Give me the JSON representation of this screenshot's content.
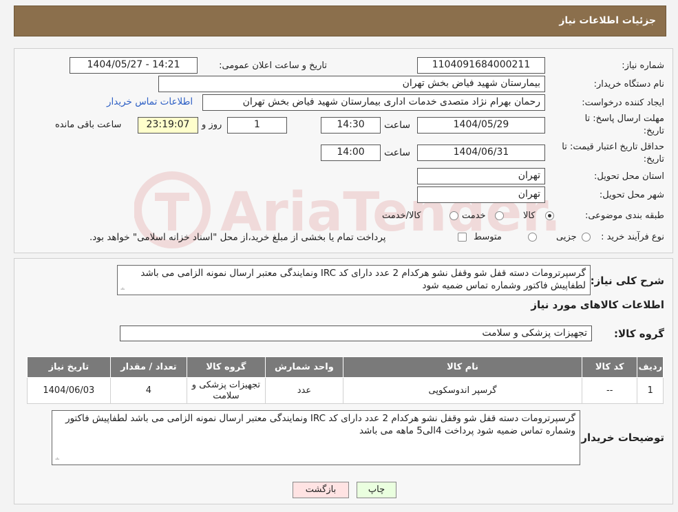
{
  "header": {
    "title": "جزئیات اطلاعات نیاز"
  },
  "form": {
    "need_number_label": "شماره نیاز:",
    "need_number": "1104091684000211",
    "announce_label": "تاریخ و ساعت اعلان عمومی:",
    "announce_value": "1404/05/27 - 14:21",
    "buyer_org_label": "نام دستگاه خریدار:",
    "buyer_org": "بیمارستان شهید فیاض بخش تهران",
    "requester_label": "ایجاد کننده درخواست:",
    "requester": "رحمان بهرام نژاد متصدی خدمات اداری بیمارستان شهید فیاض بخش تهران",
    "contact_link": "اطلاعات تماس خریدار",
    "deadline_label_1": "مهلت ارسال پاسخ: تا",
    "deadline_label_2": "تاریخ:",
    "deadline_date": "1404/05/29",
    "time_label": "ساعت",
    "deadline_time": "14:30",
    "days_value": "1",
    "days_label": "روز و",
    "remaining_time": "23:19:07",
    "remaining_label": "ساعت باقی مانده",
    "validity_label_1": "حداقل تاریخ اعتبار قیمت: تا",
    "validity_label_2": "تاریخ:",
    "validity_date": "1404/06/31",
    "validity_time": "14:00",
    "province_label": "استان محل تحویل:",
    "province": "تهران",
    "city_label": "شهر محل تحویل:",
    "city": "تهران",
    "category_label": "طبقه بندی موضوعی:",
    "category_options": [
      "کالا",
      "خدمت",
      "کالا/خدمت"
    ],
    "category_selected": "کالا",
    "process_label": "نوع فرآیند خرید :",
    "process_options": [
      "جزیی",
      "متوسط"
    ],
    "process_note": "پرداخت تمام یا بخشی از مبلغ خرید،از محل \"اسناد خزانه اسلامی\" خواهد بود."
  },
  "summary": {
    "label": "شرح کلی نیاز:",
    "text": "گرسپرترومات دسته قفل شو وقفل نشو هرکدام 2 عدد دارای کد IRC ونمایندگی معتبر ارسال نمونه الزامی می باشد لطفاپیش فاکتور وشماره تماس ضمیه شود"
  },
  "goods": {
    "title": "اطلاعات کالاهای مورد نیاز",
    "group_label": "گروه کالا:",
    "group_value": "تجهیزات پزشکی و سلامت",
    "columns": [
      "ردیف",
      "کد کالا",
      "نام کالا",
      "واحد شمارش",
      "گروه کالا",
      "تعداد / مقدار",
      "تاریخ نیاز"
    ],
    "rows": [
      [
        "1",
        "--",
        "گرسپر اندوسکوپی",
        "عدد",
        "تجهیزات پزشکی و سلامت",
        "4",
        "1404/06/03"
      ]
    ]
  },
  "buyer_notes": {
    "label": "توضیحات خریدار:",
    "text": "گرسپرترومات دسته قفل شو وقفل نشو هرکدام 2 عدد دارای کد IRC ونمایندگی معتبر ارسال نمونه الزامی می باشد لطفاپیش فاکتور وشماره تماس ضمیه شود پرداخت 4الی5 ماهه می باشد"
  },
  "buttons": {
    "print": "چاپ",
    "back": "بازگشت"
  },
  "watermark": {
    "text": "AriaTender.neT"
  },
  "colors": {
    "header_bg": "#8b6f4c",
    "table_header": "#7a7a7a",
    "link": "#2c5ec4",
    "print_btn": "#eaffdf",
    "back_btn": "#ffe3e3"
  }
}
